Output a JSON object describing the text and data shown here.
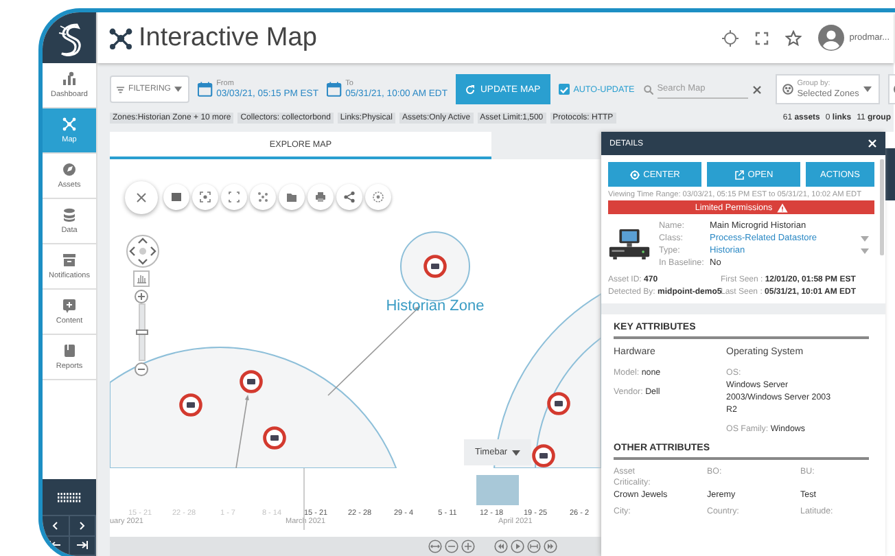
{
  "sidebar": {
    "items": [
      {
        "label": "Dashboard",
        "selected": false
      },
      {
        "label": "Map",
        "selected": true
      },
      {
        "label": "Assets",
        "selected": false
      },
      {
        "label": "Data",
        "selected": false
      },
      {
        "label": "Notifications",
        "selected": false
      },
      {
        "label": "Content",
        "selected": false
      },
      {
        "label": "Reports",
        "selected": false
      }
    ]
  },
  "header": {
    "title": "Interactive Map",
    "user": "prodmar..."
  },
  "toolbar": {
    "filter": "FILTERING",
    "from": {
      "label": "From",
      "value": "03/03/21, 05:15 PM EST"
    },
    "to": {
      "label": "To",
      "value": "05/31/21, 10:00 AM EDT"
    },
    "update_button": "UPDATE MAP",
    "auto_update": {
      "label": "AUTO-UPDATE",
      "checked": true
    },
    "search": {
      "placeholder": "Search Map"
    },
    "group_by": {
      "label": "Group by:",
      "value": "Selected Zones"
    }
  },
  "filters": {
    "chips": [
      "Zones:Historian Zone + 10 more",
      "Collectors: collectorbond",
      "Links:Physical",
      "Assets:Only Active",
      "Asset Limit:1,500",
      "Protocols: HTTP"
    ],
    "counts": [
      "61 **assets**",
      "0 **links**",
      "11 **group**"
    ]
  },
  "tabs": [
    {
      "label": "EXPLORE MAP",
      "selected": true
    }
  ],
  "map": {
    "zone_label": "Historian Zone",
    "zoom": {
      "level": 0.53
    },
    "timebar_button": "Timebar"
  },
  "timebar": {
    "weeks": [
      {
        "label": "15 - 21",
        "dimmed": true
      },
      {
        "label": "22 - 28",
        "dimmed": true
      },
      {
        "label": "1 - 7",
        "dimmed": true
      },
      {
        "label": "8 - 14",
        "dimmed": true
      },
      {
        "label": "15 - 21",
        "dimmed": false
      },
      {
        "label": "22 - 28",
        "dimmed": false
      },
      {
        "label": "29 - 4",
        "dimmed": false
      },
      {
        "label": "5 - 11",
        "dimmed": false
      },
      {
        "label": "12 - 18",
        "dimmed": false
      },
      {
        "label": "19 - 25",
        "dimmed": false
      },
      {
        "label": "26 - 2",
        "dimmed": false
      }
    ],
    "months": [
      "uary 2021",
      "March 2021",
      "April 2021"
    ]
  },
  "details": {
    "title": "DETAILS",
    "actions": [
      "CENTER",
      "OPEN",
      "ACTIONS"
    ],
    "time_range": "Viewing Time Range: 03/03/21, 05:15 PM EST to 05/31/21, 10:02 AM EDT",
    "alert": "Limited Permissions",
    "fields": [
      {
        "label": "Name:",
        "value": "Main Microgrid Historian",
        "kind": "text"
      },
      {
        "label": "Class:",
        "value": "Process-Related Datastore",
        "kind": "select"
      },
      {
        "label": "Type:",
        "value": "Historian",
        "kind": "select"
      },
      {
        "label": "In Baseline:",
        "value": "No",
        "kind": "text"
      }
    ],
    "meta": [
      {
        "label": "Asset ID:",
        "value": "470"
      },
      {
        "label": "First Seen :",
        "value": "12/01/20, 01:58 PM EST"
      },
      {
        "label": "Detected By:",
        "value": "midpoint-demo5"
      },
      {
        "label": "Last Seen :",
        "value": "05/31/21, 10:01 AM EDT"
      }
    ],
    "key_attributes": {
      "title": "KEY ATTRIBUTES",
      "columns": [
        {
          "heading": "Hardware",
          "items": [
            {
              "label": "Model:",
              "value": "none",
              "kind": "inline"
            },
            {
              "label": "Vendor:",
              "value": "Dell",
              "kind": "inline"
            }
          ]
        },
        {
          "heading": "Operating System",
          "items": [
            {
              "label": "OS:",
              "value": "Windows Server 2003/Windows Server 2003 R2",
              "kind": "stacked"
            },
            {
              "label": "OS Family:",
              "value": "Windows",
              "kind": "inline"
            }
          ]
        }
      ]
    },
    "other_attributes": {
      "title": "OTHER ATTRIBUTES",
      "items": [
        {
          "label": "Asset Criticality:",
          "value": "Crown Jewels"
        },
        {
          "label": "BO:",
          "value": "Jeremy"
        },
        {
          "label": "BU:",
          "value": "Test"
        },
        {
          "label": "City:"
        },
        {
          "label": "Country:"
        },
        {
          "label": "Latitude:"
        }
      ]
    }
  }
}
